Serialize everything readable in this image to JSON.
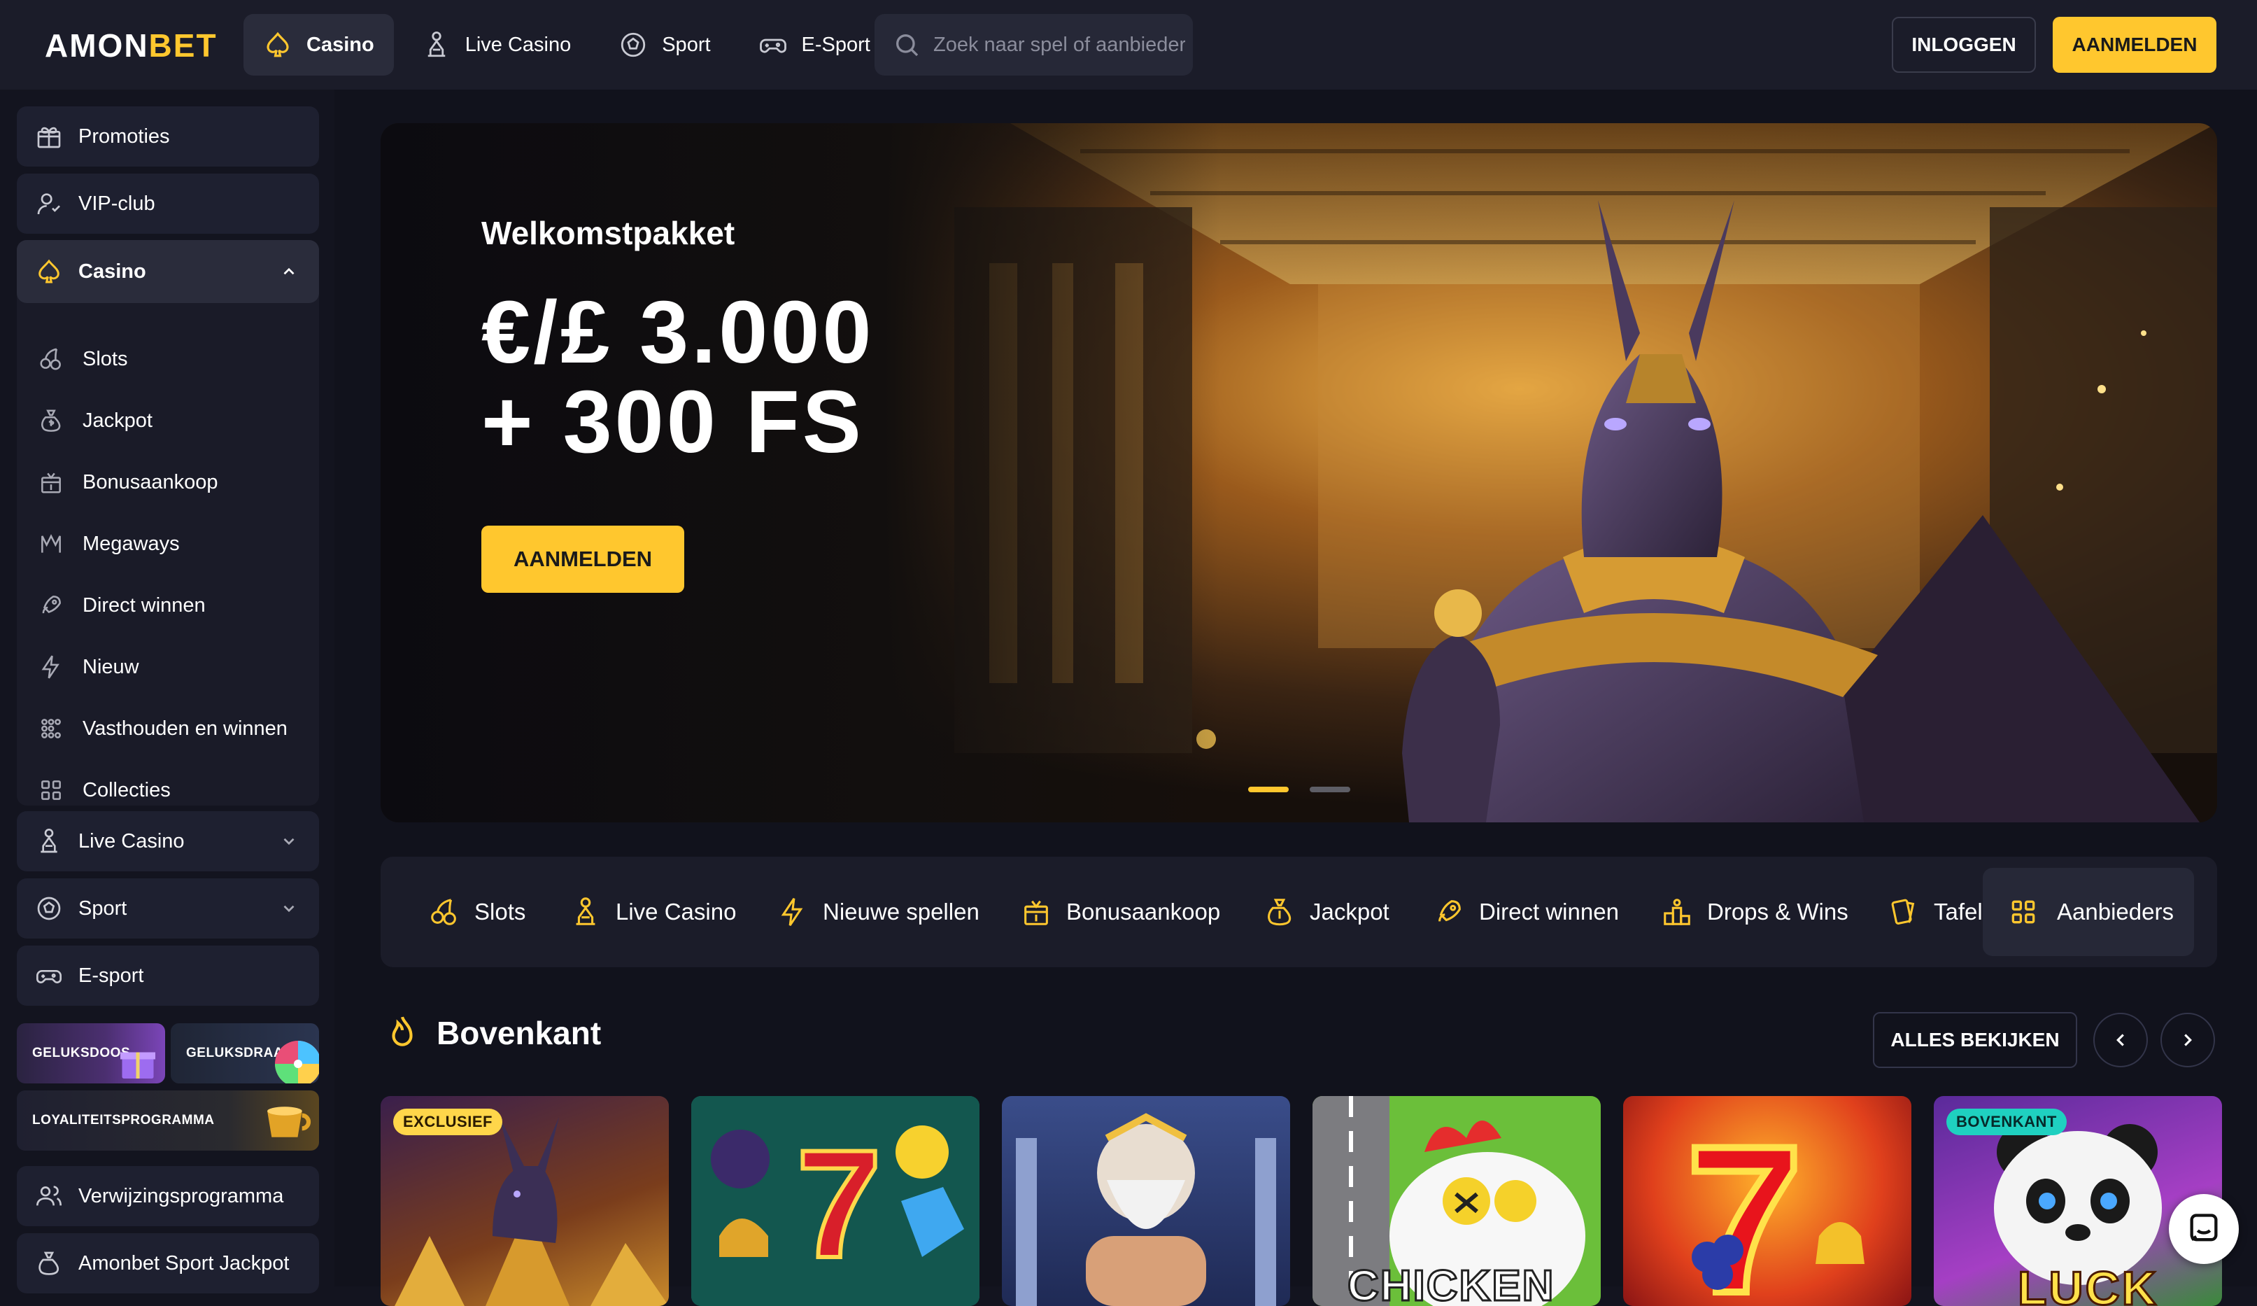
{
  "brand": {
    "logo_left": "AMON",
    "logo_accent": "BET",
    "accent_color": "#ffc72e"
  },
  "nav": {
    "items": [
      {
        "label": "Casino",
        "icon": "spade-icon",
        "active": true
      },
      {
        "label": "Live Casino",
        "icon": "dealer-icon"
      },
      {
        "label": "Sport",
        "icon": "soccer-ball-icon"
      },
      {
        "label": "E-Sport",
        "icon": "gamepad-icon"
      }
    ],
    "search_placeholder": "Zoek naar spel of aanbieder",
    "login": "INLOGGEN",
    "signup": "AANMELDEN"
  },
  "sidebar": {
    "promotions": "Promoties",
    "vip": "VIP-club",
    "casino": "Casino",
    "casino_sub": [
      "Slots",
      "Jackpot",
      "Bonusaankoop",
      "Megaways",
      "Direct winnen",
      "Nieuw",
      "Vasthouden en winnen",
      "Collecties"
    ],
    "live_casino": "Live Casino",
    "sport": "Sport",
    "esport": "E-sport",
    "tiles": {
      "box": "GELUKSDOOS",
      "wheel": "GELUKSDRAAI",
      "loyalty": "LOYALITEITSPROGRAMMA"
    },
    "referral": "Verwijzingsprogramma",
    "jackpot": "Amonbet Sport Jackpot"
  },
  "banner": {
    "title": "Welkomstpakket",
    "line1": "€/£ 3.000",
    "line2": "+ 300 FS",
    "button": "AANMELDEN",
    "slide_count": 2,
    "active_slide": 1
  },
  "categories": {
    "items": [
      "Slots",
      "Live Casino",
      "Nieuwe spellen",
      "Bonusaankoop",
      "Jackpot",
      "Direct winnen",
      "Drops & Wins",
      "Tafel"
    ],
    "providers": "Aanbieders"
  },
  "section": {
    "title": "Bovenkant",
    "see_all": "ALLES BEKIJKEN"
  },
  "games": [
    {
      "badge": "EXCLUSIEF"
    },
    {
      "badge": ""
    },
    {
      "badge": ""
    },
    {
      "badge": "",
      "title": "CHICKEN"
    },
    {
      "badge": ""
    },
    {
      "badge": "BOVENKANT",
      "title": "LUCK"
    }
  ]
}
